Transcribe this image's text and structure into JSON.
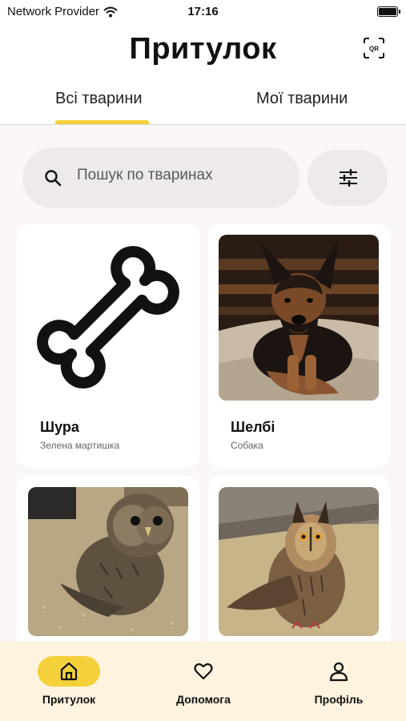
{
  "status_bar": {
    "carrier": "Network Provider",
    "time": "17:16"
  },
  "header": {
    "title": "Притулок",
    "qr_label": "QR"
  },
  "tabs": [
    {
      "label": "Всі тварини",
      "active": true
    },
    {
      "label": "Мої тварини",
      "active": false
    }
  ],
  "search": {
    "placeholder": "Пошук по тваринах"
  },
  "animals": [
    {
      "name": "Шура",
      "species": "Зелена мартишка",
      "image": "bone-placeholder"
    },
    {
      "name": "Шелбі",
      "species": "Собака",
      "image": "dog-photo"
    },
    {
      "name": "",
      "species": "",
      "image": "owl-photo"
    },
    {
      "name": "",
      "species": "",
      "image": "long-eared-owl-photo"
    }
  ],
  "bottom_nav": [
    {
      "label": "Притулок",
      "icon": "home-icon",
      "active": true
    },
    {
      "label": "Допомога",
      "icon": "heart-icon",
      "active": false
    },
    {
      "label": "Профіль",
      "icon": "user-icon",
      "active": false
    }
  ],
  "colors": {
    "accent": "#f4d13a",
    "nav_background": "#fdf3de",
    "page_background": "#fbf6fa"
  }
}
